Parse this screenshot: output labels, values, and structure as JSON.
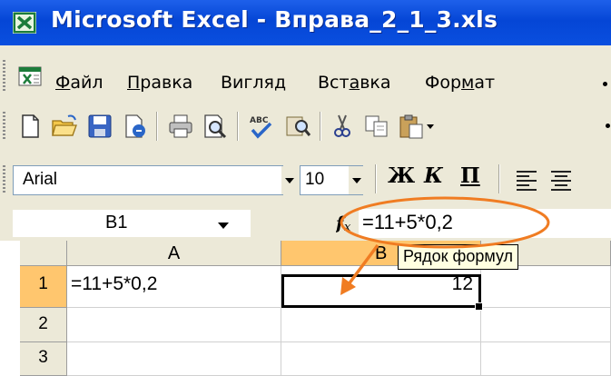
{
  "window": {
    "title": "Microsoft Excel - Вправа_2_1_3.xls"
  },
  "menu": {
    "items": [
      {
        "before": "",
        "mnemonic": "Ф",
        "after": "айл"
      },
      {
        "before": "",
        "mnemonic": "П",
        "after": "равка"
      },
      {
        "before": "Вигля",
        "mnemonic": "д",
        "after": ""
      },
      {
        "before": "Вст",
        "mnemonic": "а",
        "after": "вка"
      },
      {
        "before": "Фор",
        "mnemonic": "м",
        "after": "ат"
      }
    ]
  },
  "format": {
    "font": "Arial",
    "size": "10",
    "bold": "Ж",
    "italic": "К",
    "underline": "П"
  },
  "formula_bar": {
    "name_box": "B1",
    "fx_symbol": "fx",
    "formula": "=11+5*0,2"
  },
  "tooltip": "Рядок формул",
  "sheet": {
    "columns": [
      "A",
      "B"
    ],
    "rows": [
      "1",
      "2",
      "3"
    ],
    "cells": {
      "A1": "=11+5*0,2",
      "B1": "12"
    },
    "active_cell": "B1"
  },
  "colors": {
    "titlebar": "#0a4fdf",
    "active_header": "#ffc66e",
    "annotation": "#f07c22",
    "tooltip_bg": "#ffffe1"
  }
}
